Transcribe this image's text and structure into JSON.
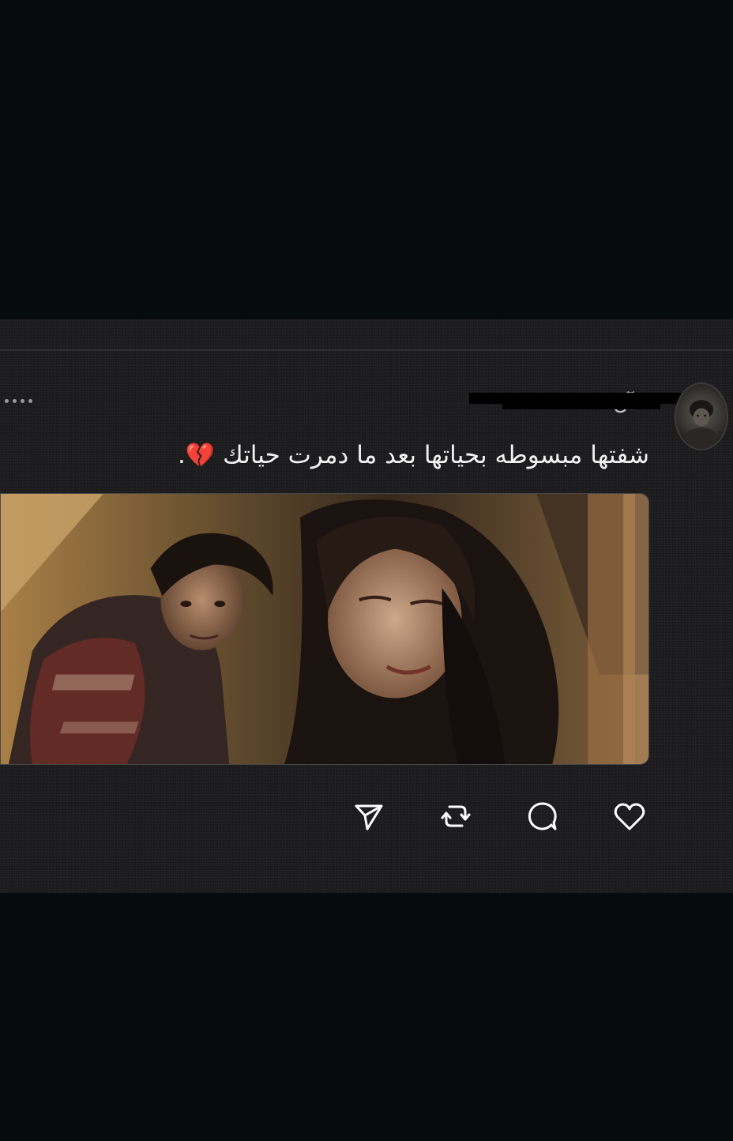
{
  "post": {
    "username": "ـلآن",
    "text": "شفتها مبسوطه  بحياتها بعد ما دمرت حياتك",
    "emoji": "💔",
    "trailing_punct": "."
  },
  "actions": {
    "like_icon": "heart-icon",
    "comment_icon": "comment-icon",
    "repost_icon": "repost-icon",
    "share_icon": "send-icon"
  },
  "colors": {
    "background": "#060b0d",
    "card": "#1c1c1e",
    "text": "#f1f1f1",
    "icon": "#ffffff"
  }
}
